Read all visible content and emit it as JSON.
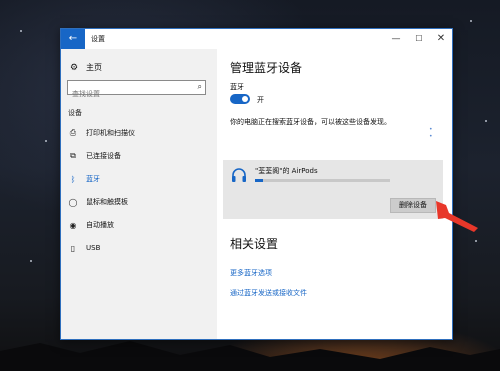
{
  "window": {
    "title": "设置"
  },
  "titlebar": {
    "back_glyph": "←",
    "minimize_glyph": "—",
    "maximize_glyph": "☐",
    "close_glyph": "✕"
  },
  "sidebar": {
    "home_label": "主页",
    "search_placeholder": "查找设置",
    "section_label": "设备",
    "items": [
      {
        "label": "打印机和扫描仪",
        "icon": "printer-icon",
        "glyph": "⎙"
      },
      {
        "label": "已连接设备",
        "icon": "connected-devices-icon",
        "glyph": "⧉"
      },
      {
        "label": "蓝牙",
        "icon": "bluetooth-icon",
        "glyph": "ᛒ",
        "active": true
      },
      {
        "label": "鼠标和触摸板",
        "icon": "mouse-icon",
        "glyph": "◯"
      },
      {
        "label": "自动播放",
        "icon": "autoplay-icon",
        "glyph": "◉"
      },
      {
        "label": "USB",
        "icon": "usb-icon",
        "glyph": "▯"
      }
    ]
  },
  "main": {
    "title": "管理蓝牙设备",
    "bluetooth_label": "蓝牙",
    "toggle_state": "开",
    "discover_text": "你的电脑正在搜索蓝牙设备，可以被这些设备发现。",
    "device": {
      "name": "\"荃荃阁\"的 AirPods",
      "progress": 0.06,
      "remove_label": "删除设备"
    },
    "related_title": "相关设置",
    "links": [
      "更多蓝牙选项",
      "通过蓝牙发送或接收文件"
    ]
  },
  "colors": {
    "accent": "#1766c6",
    "annotation_arrow": "#e8372a"
  }
}
